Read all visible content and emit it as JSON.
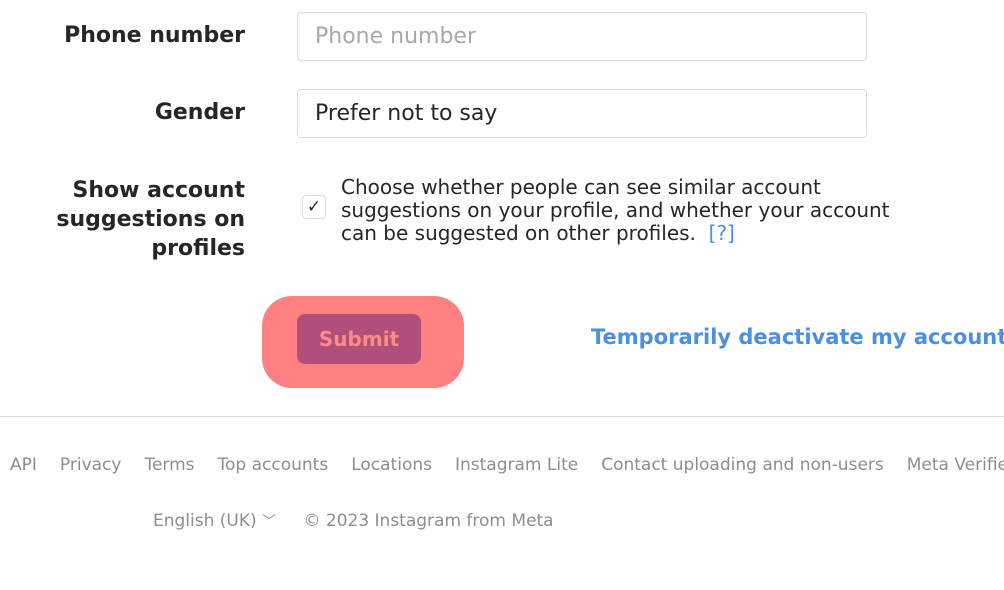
{
  "form": {
    "phone": {
      "label": "Phone number",
      "placeholder": "Phone number",
      "value": ""
    },
    "gender": {
      "label": "Gender",
      "value": "Prefer not to say"
    },
    "suggestions": {
      "label": "Show account suggestions on profiles",
      "checked": true,
      "description": "Choose whether people can see similar account suggestions on your profile, and whether your account can be suggested on other profiles.",
      "help_link": "[?]"
    },
    "submit_label": "Submit",
    "deactivate_link": "Temporarily deactivate my account"
  },
  "footer": {
    "links": [
      "API",
      "Privacy",
      "Terms",
      "Top accounts",
      "Locations",
      "Instagram Lite",
      "Contact uploading and non-users",
      "Meta Verified"
    ],
    "language": "English (UK)",
    "copyright": "© 2023 Instagram from Meta"
  },
  "colors": {
    "highlight": "#ff8080",
    "submit_bg": "#b0507a",
    "link": "#4a8fe0"
  }
}
